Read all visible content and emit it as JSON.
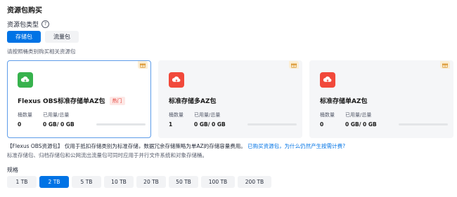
{
  "title": "资源包购买",
  "type_label": "资源包类型",
  "type_tabs": [
    {
      "label": "存储包",
      "active": true
    },
    {
      "label": "流量包",
      "active": false
    }
  ],
  "hint": "请按照桶类别购买相关资源包",
  "cards": [
    {
      "name": "Flexus OBS标准存储单AZ包",
      "badge": "热门",
      "bucket_label": "桶数量",
      "bucket_value": "0",
      "usage_label": "已用量/总量",
      "usage_value": "0 GB/ 0 GB",
      "icon_color": "#37b24d",
      "selected": true
    },
    {
      "name": "标准存储多AZ包",
      "badge": "",
      "bucket_label": "桶数量",
      "bucket_value": "1",
      "usage_label": "已用量/总量",
      "usage_value": "0 GB/ 0 GB",
      "icon_color": "#f1493b",
      "selected": false
    },
    {
      "name": "标准存储单AZ包",
      "badge": "",
      "bucket_label": "桶数量",
      "bucket_value": "0",
      "usage_label": "已用量/总量",
      "usage_value": "0 GB/ 0 GB",
      "icon_color": "#f1493b",
      "selected": false
    }
  ],
  "desc": {
    "text": "【Flexus OBS资源包】 仅用于抵扣存储类别为标准存储，数据冗余存储策略为单AZ的存储容量费用。",
    "link1": "已购买资源包，为什么仍然产生按需计费?",
    "sub": "标准存储包、归档存储包和公网流出流量包可同时应用于并行文件系统和对象存储桶。"
  },
  "spec_title": "规格",
  "specs": [
    {
      "label": "1 TB",
      "active": false
    },
    {
      "label": "2 TB",
      "active": true
    },
    {
      "label": "5 TB",
      "active": false
    },
    {
      "label": "10 TB",
      "active": false
    },
    {
      "label": "20 TB",
      "active": false
    },
    {
      "label": "50 TB",
      "active": false
    },
    {
      "label": "100 TB",
      "active": false
    },
    {
      "label": "200 TB",
      "active": false
    }
  ],
  "icons": {
    "gift": "gift-icon",
    "cloud_upload": "cloud-upload-icon",
    "help": "help-icon"
  }
}
